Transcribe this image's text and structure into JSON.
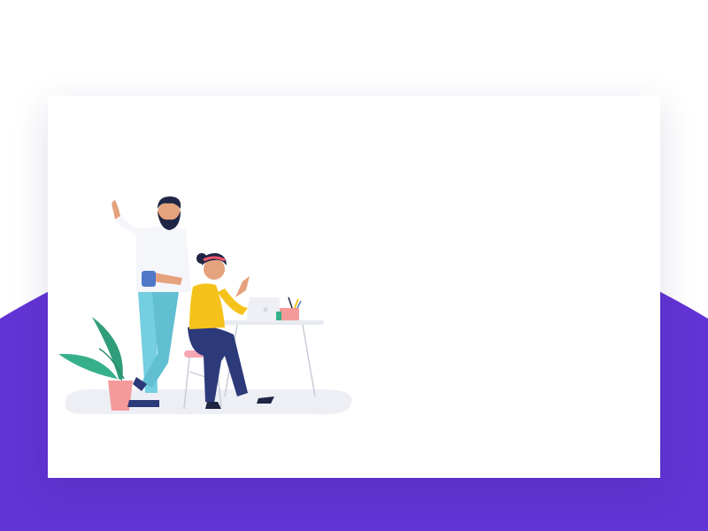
{
  "scene": {
    "description_icons": [
      "man-waving-icon",
      "woman-at-desk-icon",
      "laptop-icon",
      "plant-icon",
      "coffee-mug-icon",
      "pencil-cup-icon",
      "chair-icon",
      "desk-icon"
    ]
  },
  "colors": {
    "background_top": "#ffffff",
    "background_band": "#6234d5",
    "card": "#ffffff",
    "shirt_man": "#f5f6fa",
    "pants_man": "#74cfe0",
    "sweater_woman": "#f5c21b",
    "pants_woman": "#2c3a7a",
    "skin": "#e4a27d",
    "hair": "#1f2544",
    "headband": "#f2566f",
    "plant_leaf": "#36b08a",
    "pot": "#f49a9a",
    "chair_seat": "#f7a6b4",
    "mug": "#4f78c9",
    "floor_shadow": "#eeeff5"
  }
}
